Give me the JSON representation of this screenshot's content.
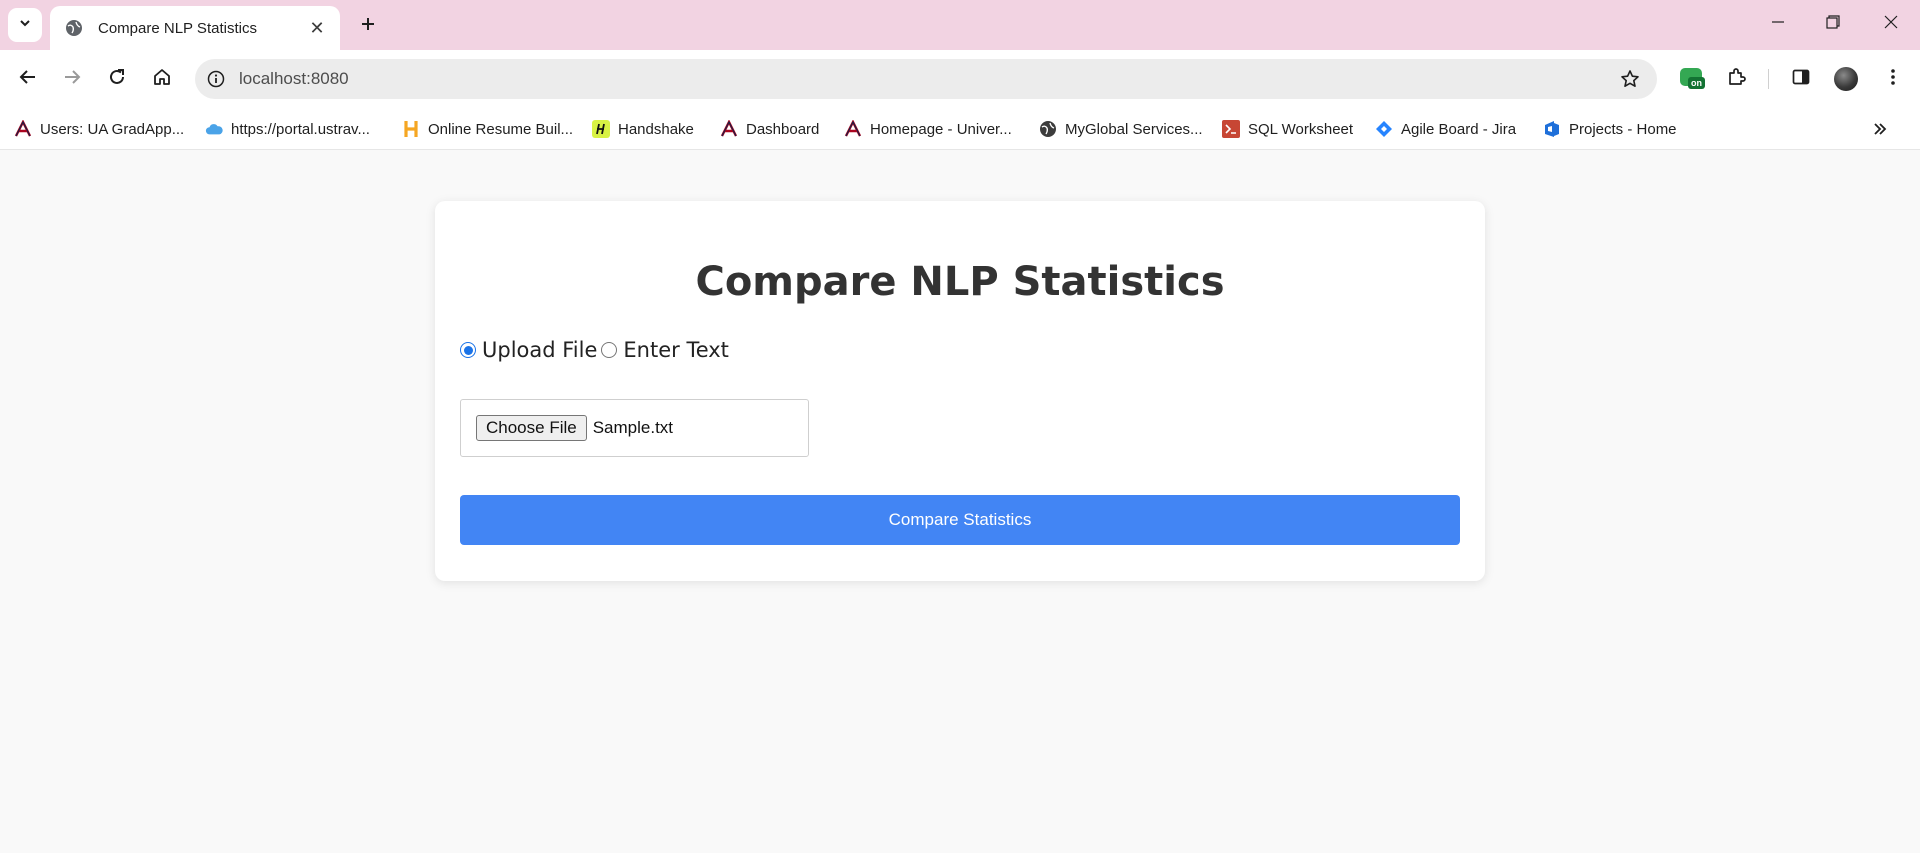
{
  "browser": {
    "tab": {
      "title": "Compare NLP Statistics"
    },
    "address_bar": {
      "url": "localhost:8080"
    },
    "extension_badge": "on",
    "bookmarks": [
      {
        "label": "Users: UA GradApp...",
        "icon": "ua-logo-icon"
      },
      {
        "label": "https://portal.ustrav...",
        "icon": "cloud-icon"
      },
      {
        "label": "Online Resume Buil...",
        "icon": "h-logo-icon"
      },
      {
        "label": "Handshake",
        "icon": "handshake-icon"
      },
      {
        "label": "Dashboard",
        "icon": "ua-logo-icon"
      },
      {
        "label": "Homepage - Univer...",
        "icon": "ua-logo-icon"
      },
      {
        "label": "MyGlobal Services...",
        "icon": "globe-icon"
      },
      {
        "label": "SQL Worksheet",
        "icon": "terminal-icon"
      },
      {
        "label": "Agile Board - Jira",
        "icon": "jira-icon"
      },
      {
        "label": "Projects - Home",
        "icon": "devops-icon"
      }
    ]
  },
  "page": {
    "title": "Compare NLP Statistics",
    "input_mode": {
      "options": [
        {
          "label": "Upload File",
          "selected": true
        },
        {
          "label": "Enter Text",
          "selected": false
        }
      ]
    },
    "file_input": {
      "button_label": "Choose File",
      "file_name": "Sample.txt"
    },
    "submit_label": "Compare Statistics"
  },
  "colors": {
    "titlebar": "#f2d3e2",
    "primary_button": "#4285f4",
    "radio_accent": "#1a73e8"
  }
}
